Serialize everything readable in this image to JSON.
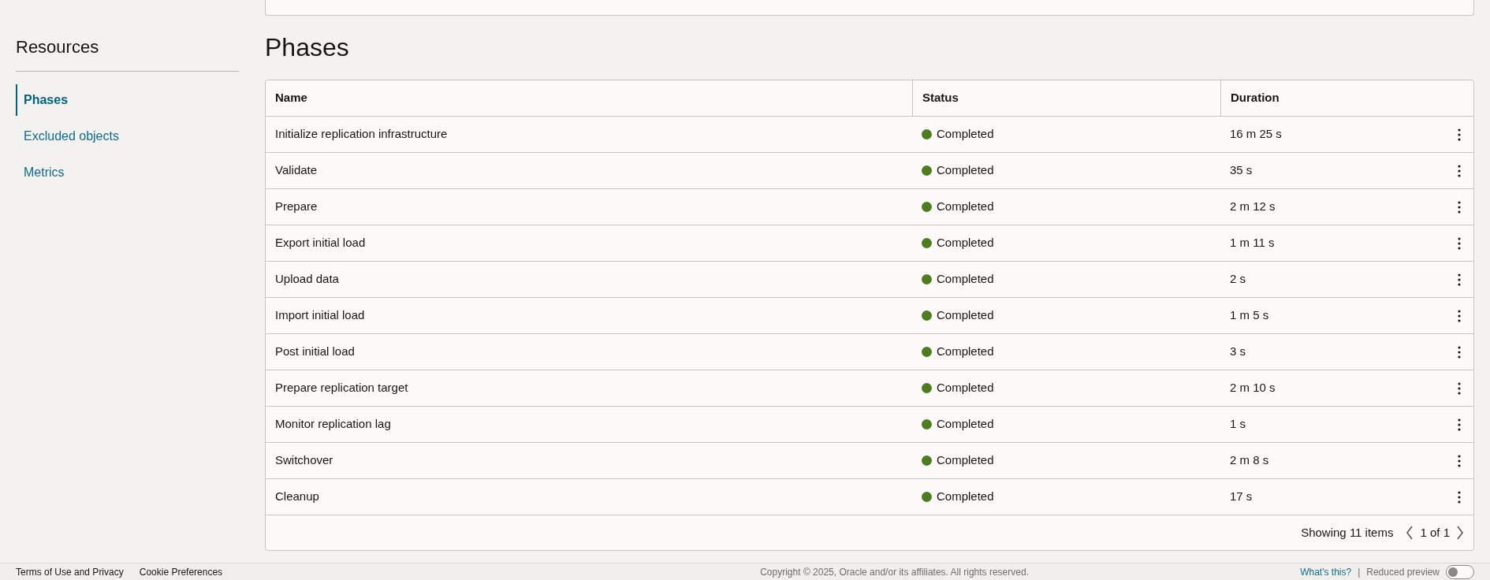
{
  "sidebar": {
    "title": "Resources",
    "items": [
      {
        "label": "Phases",
        "selected": true
      },
      {
        "label": "Excluded objects",
        "selected": false
      },
      {
        "label": "Metrics",
        "selected": false
      }
    ]
  },
  "page_title": "Phases",
  "table": {
    "columns": [
      "Name",
      "Status",
      "Duration"
    ],
    "rows": [
      {
        "name": "Initialize replication infrastructure",
        "status": "Completed",
        "color": "#4e7d1f",
        "duration": "16 m 25 s"
      },
      {
        "name": "Validate",
        "status": "Completed",
        "color": "#4e7d1f",
        "duration": "35 s"
      },
      {
        "name": "Prepare",
        "status": "Completed",
        "color": "#4e7d1f",
        "duration": "2 m 12 s"
      },
      {
        "name": "Export initial load",
        "status": "Completed",
        "color": "#4e7d1f",
        "duration": "1 m 11 s"
      },
      {
        "name": "Upload data",
        "status": "Completed",
        "color": "#4e7d1f",
        "duration": "2 s"
      },
      {
        "name": "Import initial load",
        "status": "Completed",
        "color": "#4e7d1f",
        "duration": "1 m 5 s"
      },
      {
        "name": "Post initial load",
        "status": "Completed",
        "color": "#4e7d1f",
        "duration": "3 s"
      },
      {
        "name": "Prepare replication target",
        "status": "Completed",
        "color": "#4e7d1f",
        "duration": "2 m 10 s"
      },
      {
        "name": "Monitor replication lag",
        "status": "Completed",
        "color": "#4e7d1f",
        "duration": "1 s"
      },
      {
        "name": "Switchover",
        "status": "Completed",
        "color": "#4e7d1f",
        "duration": "2 m 8 s"
      },
      {
        "name": "Cleanup",
        "status": "Completed",
        "color": "#4e7d1f",
        "duration": "17 s"
      }
    ],
    "summary": "Showing 11 items",
    "page": "1 of 1"
  },
  "footer": {
    "links": [
      "Terms of Use and Privacy",
      "Cookie Preferences"
    ],
    "copyright": "Copyright © 2025, Oracle and/or its affiliates. All rights reserved.",
    "help_link": "What's this?",
    "separator": "|",
    "preview_label": "Reduced preview",
    "preview_on": false
  }
}
